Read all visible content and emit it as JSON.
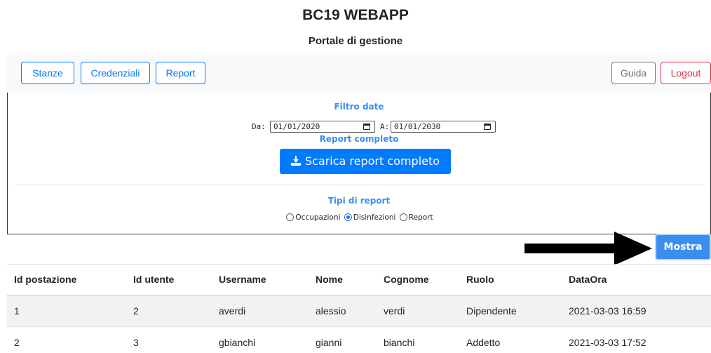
{
  "header": {
    "title": "BC19 WEBAPP",
    "subtitle": "Portale di gestione"
  },
  "navbar": {
    "left": [
      "Stanze",
      "Credenziali",
      "Report"
    ],
    "guide": "Guida",
    "logout": "Logout"
  },
  "filter": {
    "date_title": "Filtro date",
    "from_label": "Da:",
    "from_value": "01/01/2020",
    "to_label": "A:",
    "to_value": "01/01/2030",
    "full_report_title": "Report completo",
    "download_button": "Scarica report completo",
    "download_icon": "download-icon",
    "report_types_title": "Tipi di report",
    "report_types": [
      {
        "label": "Occupazioni",
        "checked": false
      },
      {
        "label": "Disinfezioni",
        "checked": true
      },
      {
        "label": "Report",
        "checked": false
      }
    ]
  },
  "show_button": "Mostra",
  "annotation": {
    "icon": "arrow-right-icon",
    "color": "#000000"
  },
  "table": {
    "headers": [
      "Id postazione",
      "Id utente",
      "Username",
      "Nome",
      "Cognome",
      "Ruolo",
      "DataOra"
    ],
    "rows": [
      [
        "1",
        "2",
        "averdi",
        "alessio",
        "verdi",
        "Dipendente",
        "2021-03-03 16:59"
      ],
      [
        "2",
        "3",
        "gbianchi",
        "gianni",
        "bianchi",
        "Addetto",
        "2021-03-03 17:52"
      ]
    ]
  },
  "colors": {
    "primary": "#007bff",
    "accent_text": "#3b8ef0",
    "secondary": "#6c757d",
    "danger": "#dc3545"
  }
}
